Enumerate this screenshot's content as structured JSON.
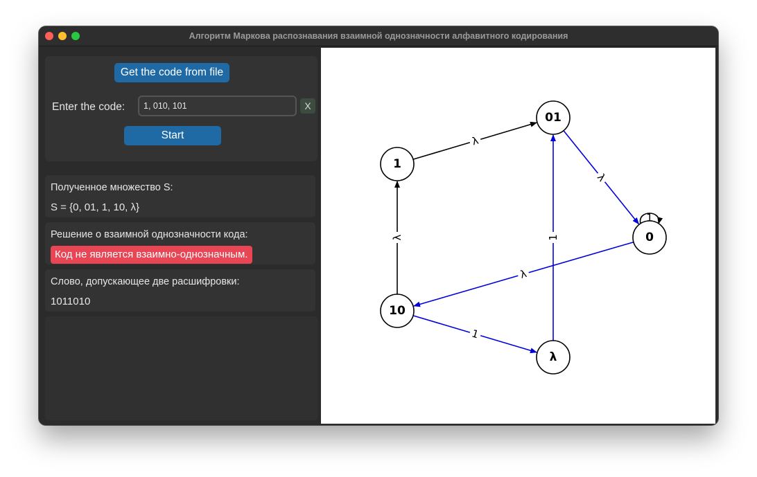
{
  "window": {
    "title": "Алгоритм Маркова распознавания взаимной однозначности алфавитного кодирования"
  },
  "controls": {
    "file_button": "Get the code from file",
    "code_label": "Enter the code:",
    "code_value": "1, 010, 101",
    "clear_button": "X",
    "start_button": "Start"
  },
  "results": {
    "set_label": "Полученное множество S:",
    "set_value": "S = {0, 01, 1, 10, λ}",
    "decision_label": "Решение о взаимной однозначности кода:",
    "decision_value": "Код не является взаимно-однозначным.",
    "word_label": "Слово, допускающее две расшифровки:",
    "word_value": "1011010"
  },
  "graph": {
    "colors": {
      "default_edge": "#000000",
      "highlight_edge": "#0000dd",
      "node_fill": "#ffffff"
    },
    "nodes": [
      {
        "id": "1",
        "label": "1"
      },
      {
        "id": "01",
        "label": "01"
      },
      {
        "id": "0",
        "label": "0"
      },
      {
        "id": "10",
        "label": "10"
      },
      {
        "id": "lambda",
        "label": "λ"
      }
    ],
    "edges": [
      {
        "from": "1",
        "to": "01",
        "label": "λ",
        "highlight": false
      },
      {
        "from": "01",
        "to": "0",
        "label": "λ",
        "highlight": true
      },
      {
        "from": "0",
        "to": "0",
        "label": "1",
        "highlight": false
      },
      {
        "from": "0",
        "to": "10",
        "label": "λ",
        "highlight": true
      },
      {
        "from": "10",
        "to": "1",
        "label": "λ",
        "highlight": false
      },
      {
        "from": "10",
        "to": "lambda",
        "label": "1",
        "highlight": true
      },
      {
        "from": "lambda",
        "to": "01",
        "label": "1",
        "highlight": true
      }
    ]
  }
}
